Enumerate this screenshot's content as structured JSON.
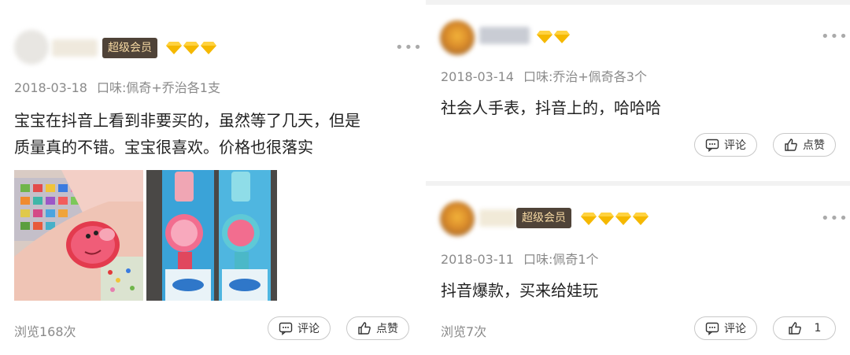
{
  "posts": [
    {
      "badge": "超级会员",
      "date": "2018-03-18",
      "flavor": "口味:佩奇+乔治各1支",
      "text_line1": "宝宝在抖音上看到非要买的，虽然等了几天，但是",
      "text_line2": "质量真的不错。宝宝很喜欢。价格也很落实",
      "views": "浏览168次",
      "comment_label": "评论",
      "like_label": "点赞"
    },
    {
      "date": "2018-03-14",
      "flavor": "口味:乔治+佩奇各3个",
      "text": "社会人手表，抖音上的，哈哈哈",
      "comment_label": "评论",
      "like_label": "点赞"
    },
    {
      "badge": "超级会员",
      "date": "2018-03-11",
      "flavor": "口味:佩奇1个",
      "text": "抖音爆款，买来给娃玩",
      "views": "浏览7次",
      "comment_label": "评论",
      "like_count": "1"
    }
  ],
  "icons": {
    "more": "more-dots-icon",
    "gem": "diamond-icon",
    "comment": "comment-icon",
    "like": "thumbs-up-icon"
  },
  "colors": {
    "badge_bg": "#4f4338",
    "badge_text": "#f6d9a3",
    "gem": "#f5b800",
    "meta": "#8a8a8a"
  }
}
